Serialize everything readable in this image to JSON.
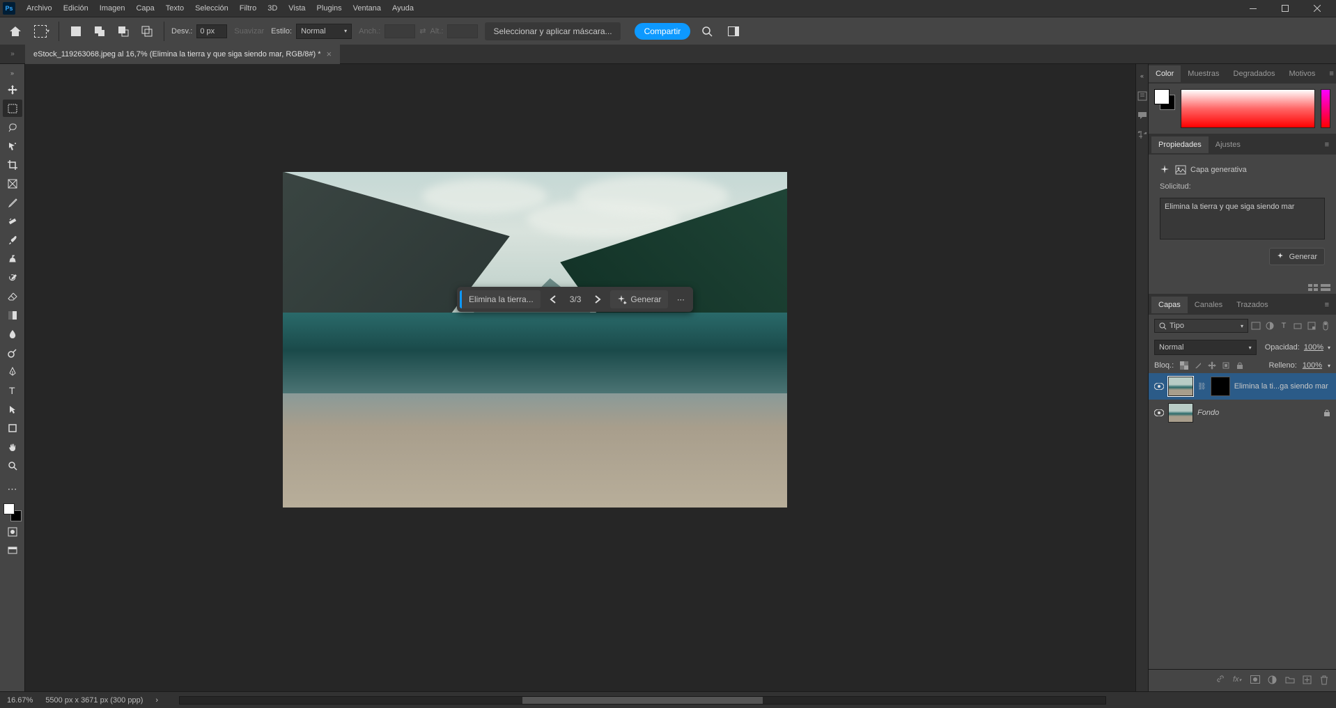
{
  "menubar": {
    "items": [
      "Archivo",
      "Edición",
      "Imagen",
      "Capa",
      "Texto",
      "Selección",
      "Filtro",
      "3D",
      "Vista",
      "Plugins",
      "Ventana",
      "Ayuda"
    ]
  },
  "optbar": {
    "desv_label": "Desv.:",
    "desv_value": "0 px",
    "suavizar": "Suavizar",
    "estilo_label": "Estilo:",
    "estilo_value": "Normal",
    "anch_label": "Anch.:",
    "alt_label": "Alt.:",
    "mask_btn": "Seleccionar y aplicar máscara...",
    "share": "Compartir"
  },
  "tab": {
    "title": "eStock_119263068.jpeg al 16,7% (Elimina la tierra y que siga siendo mar, RGB/8#) *"
  },
  "ctx": {
    "prompt_short": "Elimina la tierra...",
    "counter": "3/3",
    "generate": "Generar"
  },
  "panels": {
    "color_tabs": [
      "Color",
      "Muestras",
      "Degradados",
      "Motivos"
    ],
    "props_tabs": [
      "Propiedades",
      "Ajustes"
    ],
    "layer_type": "Capa generativa",
    "solicitud_label": "Solicitud:",
    "solicitud_text": "Elimina la tierra y que siga siendo mar",
    "generate": "Generar",
    "layers_tabs": [
      "Capas",
      "Canales",
      "Trazados"
    ],
    "filter_kind": "Tipo",
    "blend_mode": "Normal",
    "opacity_label": "Opacidad:",
    "opacity_value": "100%",
    "lock_label": "Bloq.:",
    "fill_label": "Relleno:",
    "fill_value": "100%",
    "layers": [
      {
        "name": "Elimina la ti...ga siendo mar",
        "selected": true,
        "hasMask": true,
        "locked": false
      },
      {
        "name": "Fondo",
        "selected": false,
        "hasMask": false,
        "locked": true
      }
    ]
  },
  "status": {
    "zoom": "16.67%",
    "dims": "5500 px x 3671 px (300 ppp)"
  }
}
